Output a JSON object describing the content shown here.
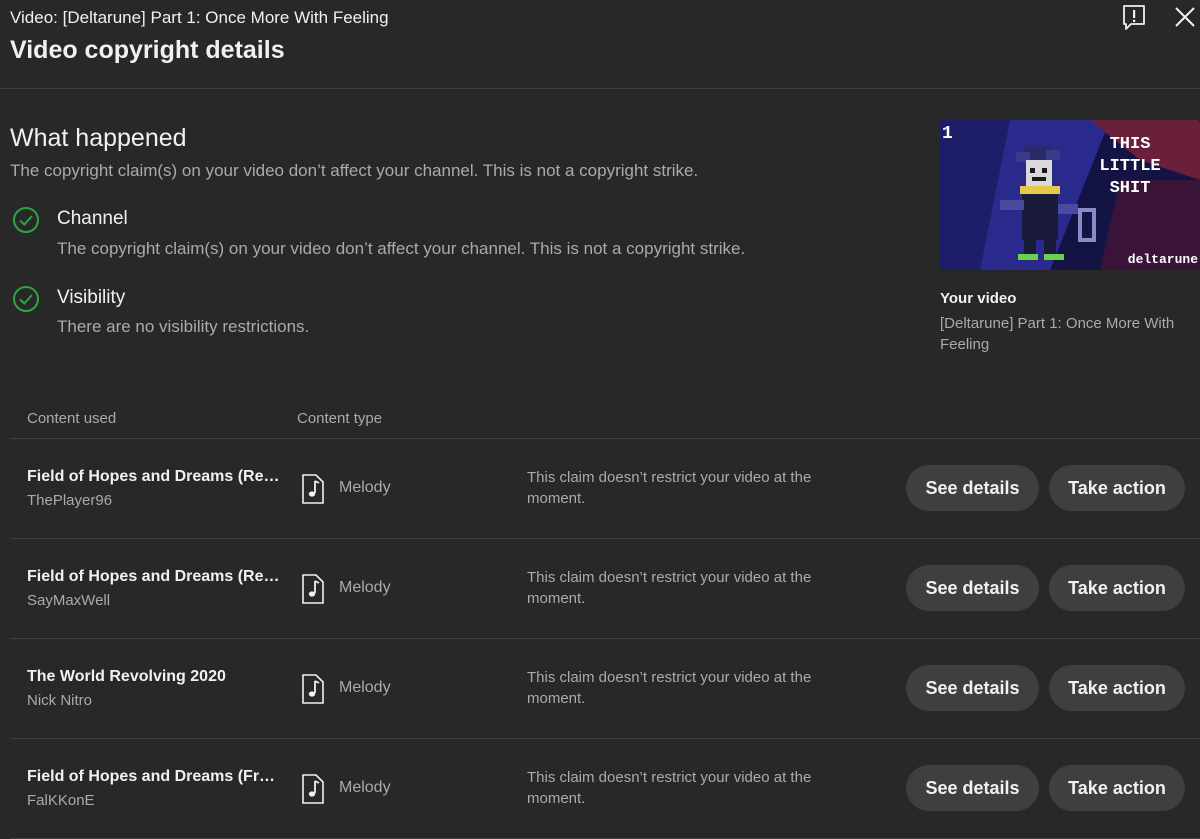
{
  "header": {
    "video_line": "Video: [Deltarune] Part 1: Once More With Feeling",
    "title": "Video copyright details"
  },
  "what_happened": {
    "title": "What happened",
    "subtitle": "The copyright claim(s) on your video don’t affect your channel. This is not a copyright strike.",
    "statuses": [
      {
        "title": "Channel",
        "description": "The copyright claim(s) on your video don’t affect your channel. This is not a copyright strike.",
        "icon": "check-circle-icon"
      },
      {
        "title": "Visibility",
        "description": "There are no visibility restrictions.",
        "icon": "check-circle-icon"
      }
    ]
  },
  "your_video": {
    "label": "Your video",
    "title": "[Deltarune] Part 1: Once More With Feeling",
    "thumbnail": {
      "badge": "1",
      "text_lines": [
        "THIS",
        "LITTLE",
        "SHIT"
      ],
      "logo": "deltarune"
    }
  },
  "table": {
    "columns": [
      "Content used",
      "Content type"
    ],
    "rows": [
      {
        "title": "Field of Hopes and Dreams (Re…",
        "artist": "ThePlayer96",
        "type": "Melody",
        "status": "This claim doesn’t restrict your video at the moment.",
        "see_details": "See details",
        "take_action": "Take action"
      },
      {
        "title": "Field of Hopes and Dreams (Re…",
        "artist": "SayMaxWell",
        "type": "Melody",
        "status": "This claim doesn’t restrict your video at the moment.",
        "see_details": "See details",
        "take_action": "Take action"
      },
      {
        "title": "The World Revolving 2020",
        "artist": "Nick Nitro",
        "type": "Melody",
        "status": "This claim doesn’t restrict your video at the moment.",
        "see_details": "See details",
        "take_action": "Take action"
      },
      {
        "title": "Field of Hopes and Dreams (Fro…",
        "artist": "FalKKonE",
        "type": "Melody",
        "status": "This claim doesn’t restrict your video at the moment.",
        "see_details": "See details",
        "take_action": "Take action"
      }
    ]
  },
  "colors": {
    "background": "#282828",
    "button": "#3f3f3f",
    "check_green": "#2ba640",
    "muted_text": "#aaaaaa"
  }
}
